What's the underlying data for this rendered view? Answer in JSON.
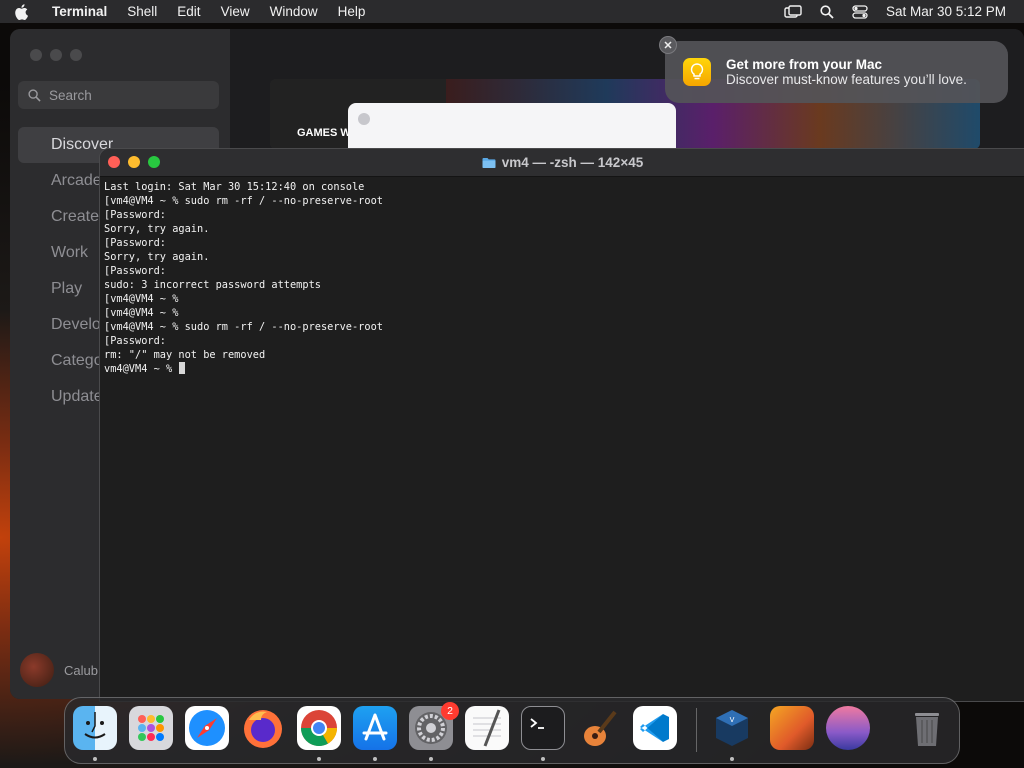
{
  "menubar": {
    "app_name": "Terminal",
    "menus": [
      "Shell",
      "Edit",
      "View",
      "Window",
      "Help"
    ],
    "clock": "Sat Mar 30  5:12 PM",
    "status_icons": [
      "screen-mirroring-icon",
      "spotlight-search-icon",
      "control-center-icon"
    ]
  },
  "appstore": {
    "search_placeholder": "Search",
    "nav": [
      "Discover",
      "Arcade",
      "Create",
      "Work",
      "Play",
      "Develop",
      "Categories",
      "Updates"
    ],
    "active_nav": "Discover",
    "hero_label": "GAMES W",
    "user_name": "Calub"
  },
  "notification": {
    "title": "Get more from your Mac",
    "body": "Discover must-know features you’ll love.",
    "icon": "lightbulb-icon"
  },
  "terminal": {
    "title": "vm4 — -zsh — 142×45",
    "lines": [
      "Last login: Sat Mar 30 15:12:40 on console",
      "[vm4@VM4 ~ % sudo rm -rf / --no-preserve-root",
      "[Password:",
      "Sorry, try again.",
      "[Password:",
      "Sorry, try again.",
      "[Password:",
      "sudo: 3 incorrect password attempts",
      "[vm4@VM4 ~ %",
      "[vm4@VM4 ~ %",
      "[vm4@VM4 ~ % sudo rm -rf / --no-preserve-root",
      "[Password:",
      "rm: \"/\" may not be removed"
    ],
    "prompt": "vm4@VM4 ~ % "
  },
  "dock": {
    "apps": [
      {
        "name": "Finder",
        "icon": "finder-icon",
        "running": true
      },
      {
        "name": "Launchpad",
        "icon": "launchpad-icon",
        "running": false
      },
      {
        "name": "Safari",
        "icon": "safari-icon",
        "running": false
      },
      {
        "name": "Firefox",
        "icon": "firefox-icon",
        "running": false
      },
      {
        "name": "Google Chrome",
        "icon": "chrome-icon",
        "running": true
      },
      {
        "name": "App Store",
        "icon": "app-store-icon",
        "running": true
      },
      {
        "name": "System Settings",
        "icon": "system-settings-icon",
        "running": true,
        "badge": "2"
      },
      {
        "name": "TextEdit",
        "icon": "textedit-icon",
        "running": false
      },
      {
        "name": "Terminal",
        "icon": "terminal-icon",
        "running": true
      },
      {
        "name": "GarageBand",
        "icon": "garageband-icon",
        "running": false
      },
      {
        "name": "Visual Studio Code",
        "icon": "vscode-icon",
        "running": false
      },
      {
        "name": "VirtualBox",
        "icon": "virtualbox-icon",
        "running": true
      },
      {
        "name": "Ventura Wallpaper",
        "icon": "wallpaper-icon",
        "running": false
      },
      {
        "name": "Sonoma Wallpaper",
        "icon": "wallpaper-circle-icon",
        "running": false
      },
      {
        "name": "Trash",
        "icon": "trash-icon",
        "running": false
      }
    ]
  }
}
